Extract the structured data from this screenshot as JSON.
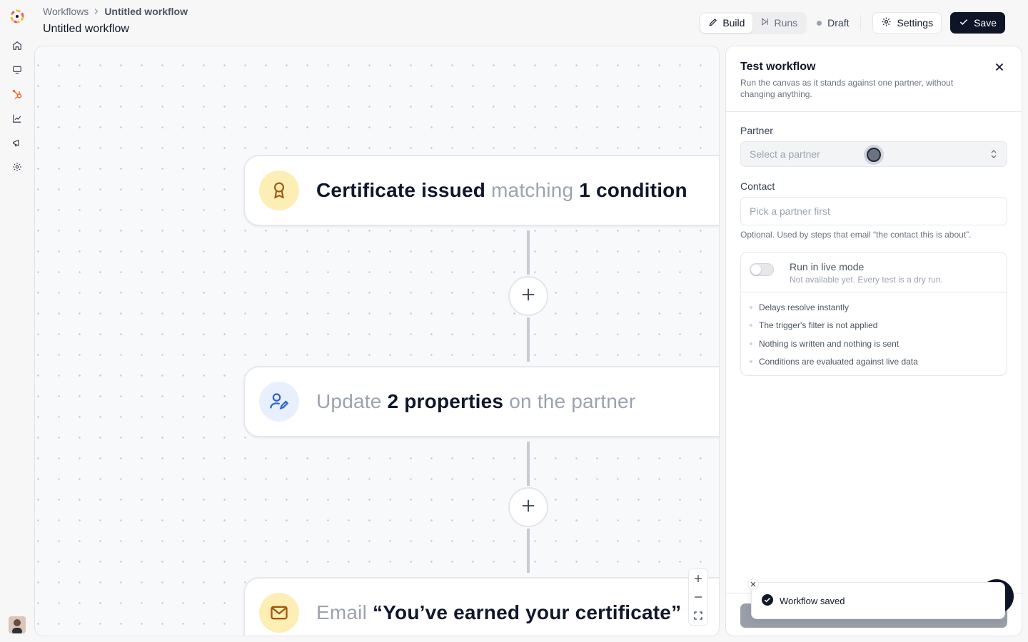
{
  "rail": {
    "logo_icon": "sun-logo-icon",
    "nav": [
      {
        "name": "home-icon"
      },
      {
        "name": "monitor-icon"
      },
      {
        "name": "hubspot-icon",
        "color": "#f0672f"
      },
      {
        "name": "chart-line-icon"
      },
      {
        "name": "megaphone-icon"
      },
      {
        "name": "gear-icon"
      }
    ],
    "avatar": "user-avatar"
  },
  "header": {
    "breadcrumb_root": "Workflows",
    "breadcrumb_current": "Untitled workflow",
    "title": "Untitled workflow",
    "build_label": "Build",
    "runs_label": "Runs",
    "status_label": "Draft",
    "settings_label": "Settings",
    "save_label": "Save"
  },
  "canvas": {
    "nodes": [
      {
        "icon": "award-icon",
        "icon_bg": "#fdeeb6",
        "icon_color": "#a1590a",
        "parts": [
          {
            "text": "Certificate issued",
            "style": "strong"
          },
          {
            "text": "matching",
            "style": "muted"
          },
          {
            "text": "1 condition",
            "style": "strong"
          }
        ]
      },
      {
        "icon": "user-edit-icon",
        "icon_bg": "#e8f0fd",
        "icon_color": "#2c62d6",
        "parts": [
          {
            "text": "Update",
            "style": "muted"
          },
          {
            "text": "2 properties",
            "style": "strong"
          },
          {
            "text": "on the partner",
            "style": "muted"
          }
        ]
      },
      {
        "icon": "mail-icon",
        "icon_bg": "#fdeeb6",
        "icon_color": "#a1590a",
        "parts": [
          {
            "text": "Email",
            "style": "muted"
          },
          {
            "text": "“You’ve earned your certificate”",
            "style": "strong"
          }
        ]
      }
    ]
  },
  "panel": {
    "title": "Test workflow",
    "subtitle": "Run the canvas as it stands against one partner, without changing anything.",
    "partner_label": "Partner",
    "partner_placeholder": "Select a partner",
    "contact_label": "Contact",
    "contact_placeholder": "Pick a partner first",
    "contact_helper": "Optional. Used by steps that email “the contact this is about”.",
    "live_mode_label": "Run in live mode",
    "live_mode_sub": "Not available yet. Every test is a dry run.",
    "live_mode_on": false,
    "notes": [
      "Delays resolve instantly",
      "The trigger's filter is not applied",
      "Nothing is written and nothing is sent",
      "Conditions are evaluated against live data"
    ]
  },
  "toast": {
    "message": "Workflow saved"
  }
}
